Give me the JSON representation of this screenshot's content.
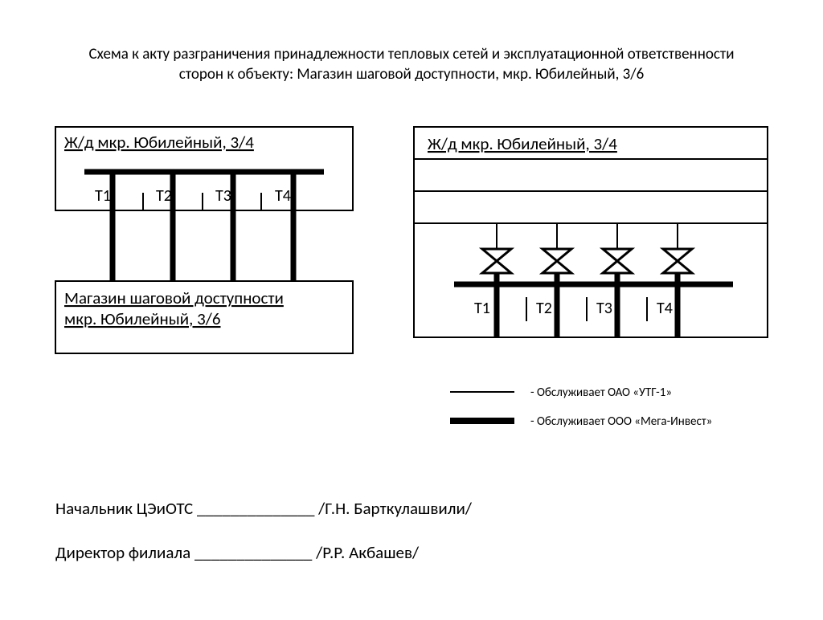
{
  "title_line1": "Схема к акту разграничения принадлежности тепловых сетей и эксплуатационной ответственности",
  "title_line2": "сторон к объекту: Магазин шаговой доступности, мкр. Юбилейный, 3/6",
  "left": {
    "top_box": "Ж/д мкр. Юбилейный, 3/4",
    "bottom_box_l1": "Магазин шаговой доступности",
    "bottom_box_l2": "мкр. Юбилейный, 3/6",
    "labels": [
      "Т1",
      "Т2",
      "Т3",
      "Т4"
    ]
  },
  "right": {
    "top_row": "Ж/д мкр. Юбилейный, 3/4",
    "labels": [
      "Т1",
      "Т2",
      "Т3",
      "Т4"
    ]
  },
  "legend": {
    "thin": "- Обслуживает ОАО «УТГ-1»",
    "thick": "- Обслуживает ООО «Мега-Инвест»"
  },
  "sign1_label": "Начальник ЦЭиОТС",
  "sign1_name": "/Г.Н. Барткулашвили/",
  "sign2_label": "Директор филиала",
  "sign2_name": "/Р.Р. Акбашев/",
  "blank": "______________"
}
